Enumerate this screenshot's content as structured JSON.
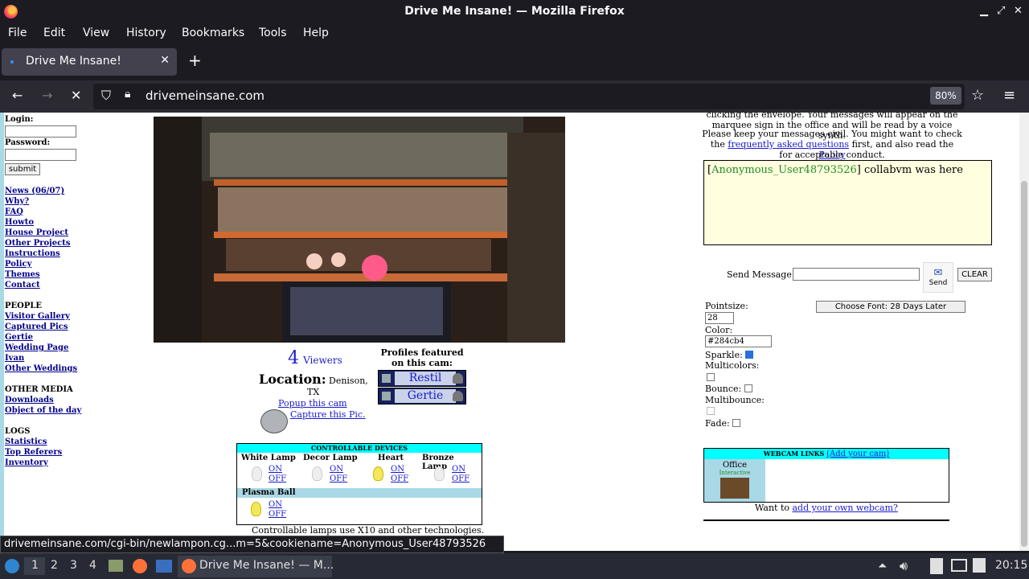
{
  "window": {
    "title": "Drive Me Insane! — Mozilla Firefox"
  },
  "menu": [
    "File",
    "Edit",
    "View",
    "History",
    "Bookmarks",
    "Tools",
    "Help"
  ],
  "tab": {
    "label": "Drive Me Insane!",
    "new_tab": "+"
  },
  "url": {
    "text": "drivemeinsane.com",
    "zoom": "80%"
  },
  "sidebar": {
    "login_label": "Login:",
    "password_label": "Password:",
    "submit": "submit",
    "links": [
      "News (06/07)",
      "Why?",
      "FAQ",
      "Howto",
      "House Project",
      "Other Projects",
      "Instructions",
      "Policy",
      "Themes",
      "Contact"
    ],
    "people_head": "PEOPLE",
    "people": [
      "Visitor Gallery",
      "Captured Pics",
      "Gertie",
      "Wedding Page",
      "Ivan",
      "Other Weddings"
    ],
    "media_head": "OTHER MEDIA",
    "media": [
      "Downloads",
      "Object of the day"
    ],
    "logs_head": "LOGS",
    "logs": [
      "Statistics",
      "Top Referers",
      "Inventory"
    ]
  },
  "cam": {
    "viewers_count": "4",
    "viewers_word": "Viewers",
    "location_label": "Location:",
    "location_city": "Denison,",
    "location_state": "TX",
    "popup": "Popup this cam",
    "capture": "Capture this Pic.",
    "profiles_head": "Profiles featured on this cam:",
    "profiles": [
      "Restil",
      "Gertie"
    ]
  },
  "devices": {
    "head": "CONTROLLABLE DEVICES",
    "items": [
      {
        "name": "White Lamp",
        "on": "ON",
        "off": "OFF"
      },
      {
        "name": "Decor Lamp",
        "on": "ON",
        "off": "OFF"
      },
      {
        "name": "Heart",
        "on": "ON",
        "off": "OFF"
      },
      {
        "name": "Bronze Lamp",
        "on": "ON",
        "off": "OFF"
      }
    ],
    "plasma": {
      "name": "Plasma Ball",
      "on": "ON",
      "off": "OFF"
    },
    "note": "Controllable lamps use X10 and other technologies."
  },
  "chat": {
    "intro_line1": "clicking the envelope. Your messages will appear on the",
    "intro_line2": "marquee sign in the office and will be read by a voice synth.",
    "intro_line3": "Please keep your messages civil. You might want to check",
    "intro_the": "the",
    "intro_faq": "frequently asked questions",
    "intro_mid": "first, and also read the",
    "intro_policy": "Policy",
    "intro_line5": "for acceptable conduct.",
    "user": "Anonymous_User48793526",
    "message": "collabvm was here",
    "send_label": "Send Message:",
    "send_btn": "Send",
    "clear_btn": "CLEAR",
    "pointsize_label": "Pointsize:",
    "pointsize": "28",
    "color_label": "Color:",
    "color": "#284cb4",
    "font_btn": "Choose Font: 28 Days Later",
    "sparkle_label": "Sparkle:",
    "multicolors_label": "Multicolors:",
    "bounce_label": "Bounce:",
    "multibounce_label": "Multibounce:",
    "fade_label": "Fade:"
  },
  "webcam_links": {
    "head": "WEBCAM LINKS",
    "add_link": "(Add your cam)",
    "cam_name": "Office",
    "cam_type": "Interactive",
    "want_text": "Want to",
    "want_link": "add your own webcam?"
  },
  "status": {
    "url": "drivemeinsane.com/cgi-bin/newlampon.cg...m=5&cookiename=Anonymous_User48793526"
  },
  "taskbar": {
    "workspaces": [
      "1",
      "2",
      "3",
      "4"
    ],
    "task": "Drive Me Insane! — M...",
    "clock": "20:15"
  }
}
